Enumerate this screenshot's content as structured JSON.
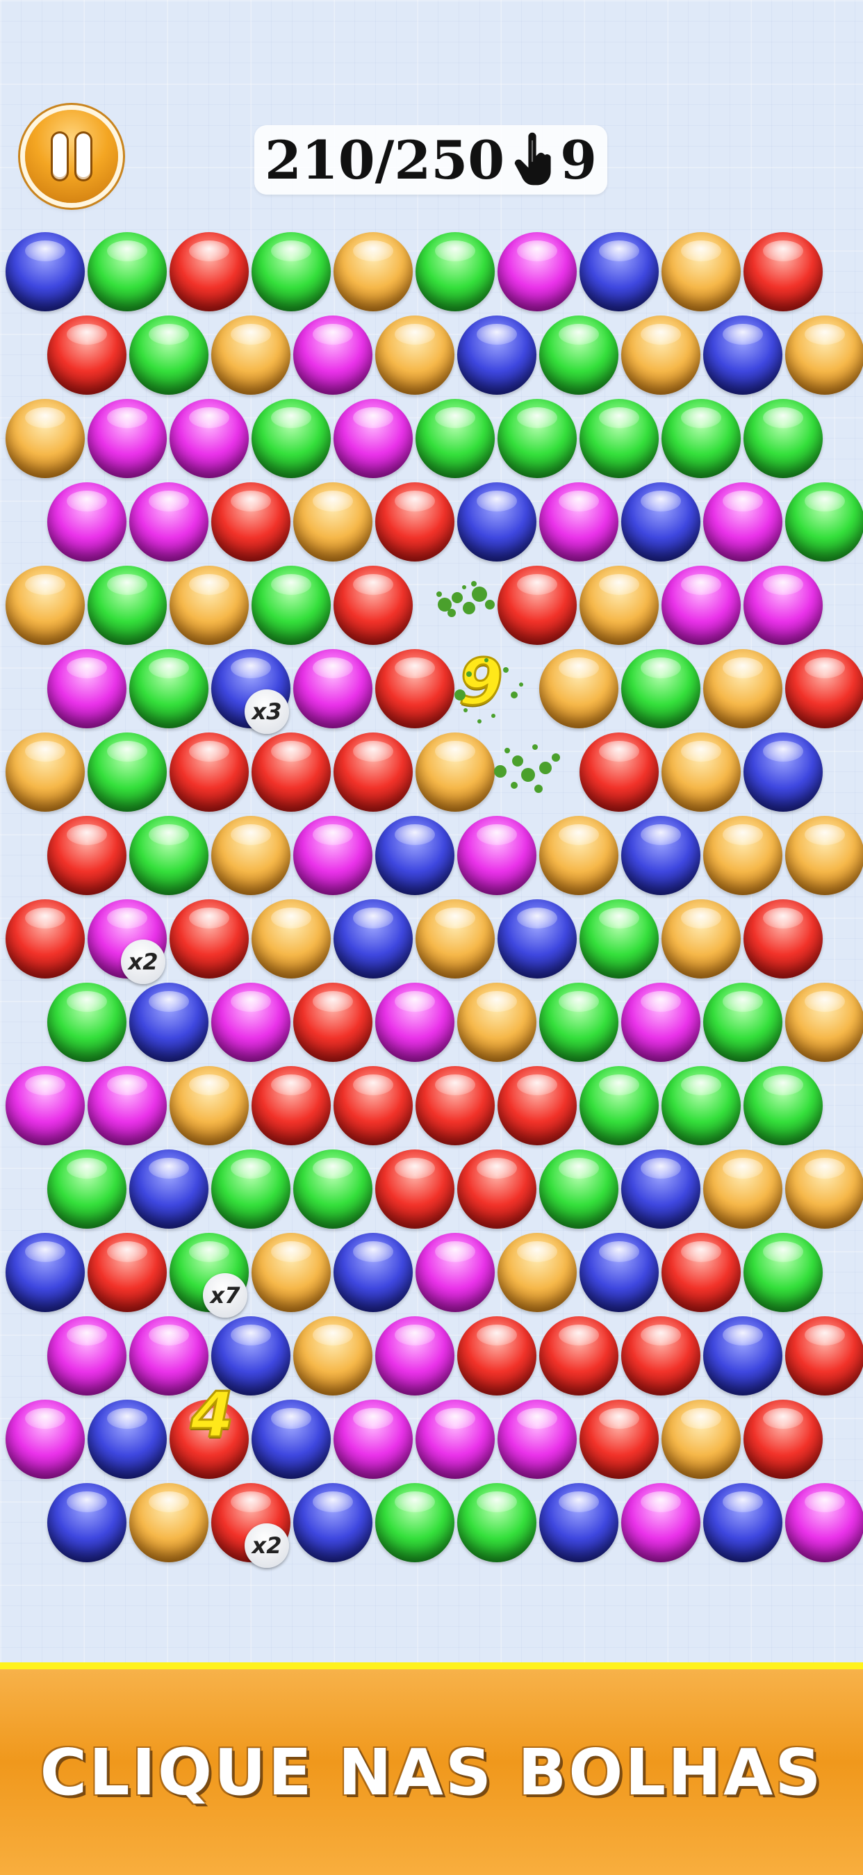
{
  "hud": {
    "pause_icon": "pause-icon",
    "score": "210/250",
    "tap_icon": "tap-hand-icon",
    "taps_left": "9"
  },
  "colors": {
    "blue": "#3f48e0",
    "green": "#35e03c",
    "red": "#f2332a",
    "orange": "#f6b84a",
    "magenta": "#ea33ea",
    "banner": "#f0981c",
    "banner_border": "#fff21c"
  },
  "board": {
    "rows": [
      [
        "B",
        "G",
        "R",
        "G",
        "O",
        "G",
        "M",
        "B",
        "O",
        "R"
      ],
      [
        "R",
        "G",
        "O",
        "M",
        "O",
        "B",
        "G",
        "O",
        "B",
        "O"
      ],
      [
        "O",
        "M",
        "M",
        "G",
        "M",
        "G",
        "G",
        "G",
        "G",
        "G"
      ],
      [
        "M",
        "M",
        "R",
        "O",
        "R",
        "B",
        "M",
        "B",
        "M",
        "G"
      ],
      [
        "O",
        "G",
        "O",
        "G",
        "R",
        "_",
        "R",
        "O",
        "M",
        "M"
      ],
      [
        "M",
        "G",
        "B",
        "M",
        "R",
        "_",
        "O",
        "G",
        "O",
        "R"
      ],
      [
        "O",
        "G",
        "R",
        "R",
        "R",
        "O",
        "_",
        "R",
        "O",
        "B"
      ],
      [
        "R",
        "G",
        "O",
        "M",
        "B",
        "M",
        "O",
        "B",
        "O",
        "O"
      ],
      [
        "R",
        "M",
        "R",
        "O",
        "B",
        "O",
        "B",
        "G",
        "O",
        "R"
      ],
      [
        "G",
        "B",
        "M",
        "R",
        "M",
        "O",
        "G",
        "M",
        "G",
        "O"
      ],
      [
        "M",
        "M",
        "O",
        "R",
        "R",
        "R",
        "R",
        "G",
        "G",
        "G"
      ],
      [
        "G",
        "B",
        "G",
        "G",
        "R",
        "R",
        "G",
        "B",
        "O",
        "O"
      ],
      [
        "B",
        "R",
        "G",
        "O",
        "B",
        "M",
        "O",
        "B",
        "R",
        "G"
      ],
      [
        "M",
        "M",
        "B",
        "O",
        "M",
        "R",
        "R",
        "R",
        "B",
        "R"
      ],
      [
        "M",
        "B",
        "R",
        "B",
        "M",
        "M",
        "M",
        "R",
        "O",
        "R"
      ],
      [
        "B",
        "O",
        "R",
        "B",
        "G",
        "G",
        "B",
        "M",
        "B",
        "M"
      ]
    ],
    "multipliers": [
      {
        "row": 5,
        "col": 2,
        "label": "x3"
      },
      {
        "row": 8,
        "col": 1,
        "label": "x2"
      },
      {
        "row": 12,
        "col": 2,
        "label": "x7"
      },
      {
        "row": 15,
        "col": 2,
        "label": "x2"
      }
    ],
    "pop_numbers": [
      {
        "label": "9",
        "row": 5,
        "col": 5
      },
      {
        "label": "4",
        "row": 14,
        "col": 2
      }
    ]
  },
  "banner": {
    "text": "CLIQUE NAS BOLHAS"
  }
}
